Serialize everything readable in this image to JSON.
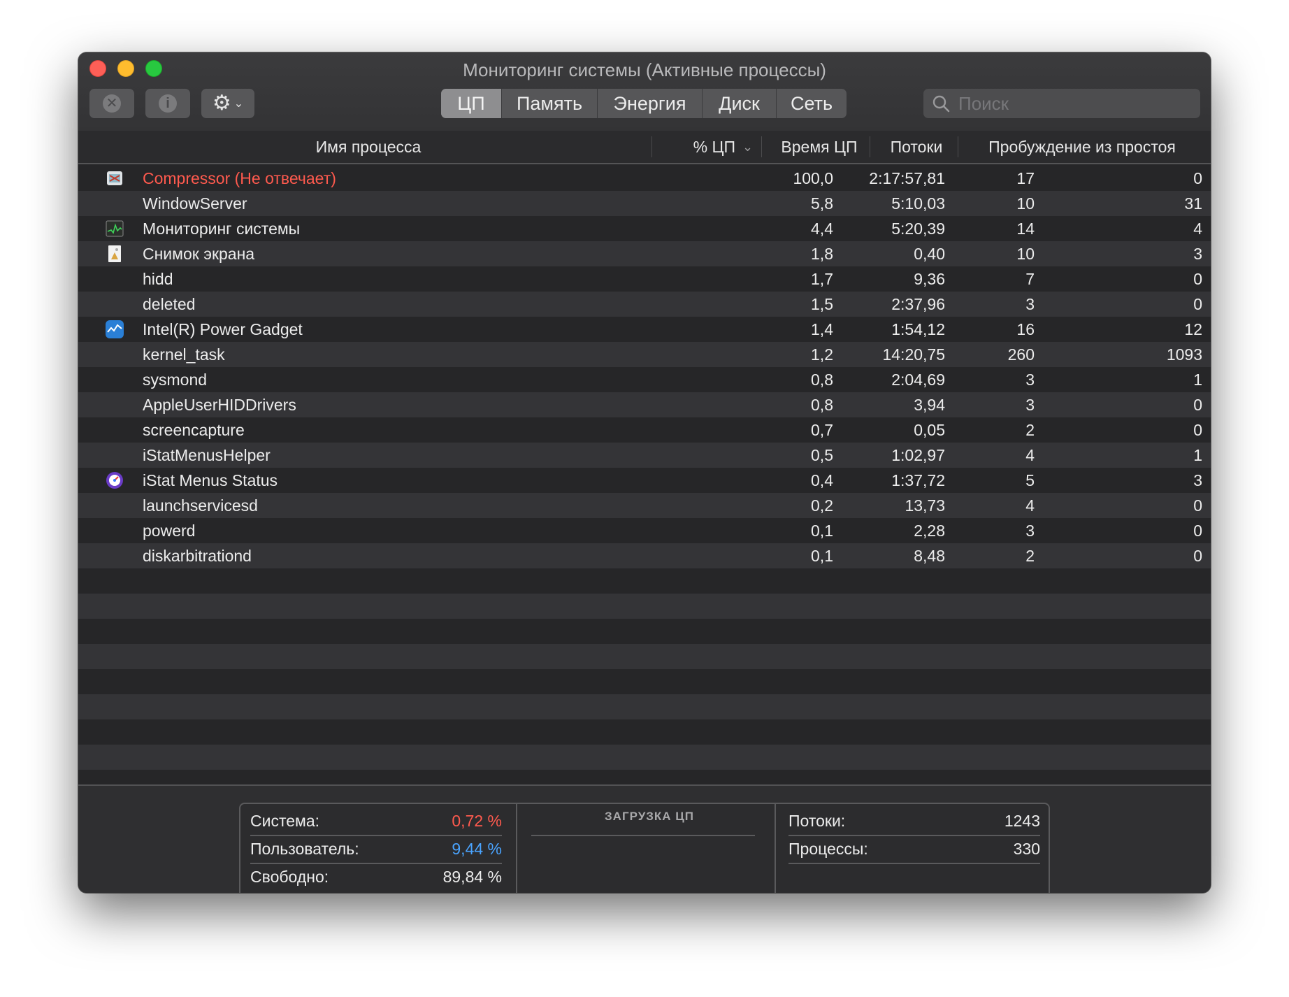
{
  "window": {
    "title": "Мониторинг системы (Активные процессы)"
  },
  "toolbar": {
    "stop_icon": "x-circle-icon",
    "info_icon": "info-icon",
    "gear_icon": "gear-icon",
    "tabs": [
      {
        "label": "ЦП",
        "active": true
      },
      {
        "label": "Память",
        "active": false
      },
      {
        "label": "Энергия",
        "active": false
      },
      {
        "label": "Диск",
        "active": false
      },
      {
        "label": "Сеть",
        "active": false
      }
    ],
    "search_placeholder": "Поиск",
    "search_value": ""
  },
  "table": {
    "columns": {
      "name": "Имя процесса",
      "cpu": "% ЦП",
      "time": "Время ЦП",
      "threads": "Потоки",
      "wake": "Пробуждение из простоя"
    },
    "sort": {
      "column": "cpu",
      "direction": "descending"
    },
    "rows": [
      {
        "icon": "compressor-app-icon",
        "name": "Compressor (Не отвечает)",
        "cpu": "100,0",
        "time": "2:17:57,81",
        "threads": "17",
        "wake": "0",
        "not_responding": true
      },
      {
        "icon": "",
        "name": "WindowServer",
        "cpu": "5,8",
        "time": "5:10,03",
        "threads": "10",
        "wake": "31"
      },
      {
        "icon": "activity-monitor-app-icon",
        "name": "Мониторинг системы",
        "cpu": "4,4",
        "time": "5:20,39",
        "threads": "14",
        "wake": "4"
      },
      {
        "icon": "screenshot-app-icon",
        "name": "Снимок экрана",
        "cpu": "1,8",
        "time": "0,40",
        "threads": "10",
        "wake": "3"
      },
      {
        "icon": "",
        "name": "hidd",
        "cpu": "1,7",
        "time": "9,36",
        "threads": "7",
        "wake": "0"
      },
      {
        "icon": "",
        "name": "deleted",
        "cpu": "1,5",
        "time": "2:37,96",
        "threads": "3",
        "wake": "0"
      },
      {
        "icon": "power-gadget-app-icon",
        "name": "Intel(R) Power Gadget",
        "cpu": "1,4",
        "time": "1:54,12",
        "threads": "16",
        "wake": "12"
      },
      {
        "icon": "",
        "name": "kernel_task",
        "cpu": "1,2",
        "time": "14:20,75",
        "threads": "260",
        "wake": "1093"
      },
      {
        "icon": "",
        "name": "sysmond",
        "cpu": "0,8",
        "time": "2:04,69",
        "threads": "3",
        "wake": "1"
      },
      {
        "icon": "",
        "name": "AppleUserHIDDrivers",
        "cpu": "0,8",
        "time": "3,94",
        "threads": "3",
        "wake": "0"
      },
      {
        "icon": "",
        "name": "screencapture",
        "cpu": "0,7",
        "time": "0,05",
        "threads": "2",
        "wake": "0"
      },
      {
        "icon": "",
        "name": "iStatMenusHelper",
        "cpu": "0,5",
        "time": "1:02,97",
        "threads": "4",
        "wake": "1"
      },
      {
        "icon": "istat-menus-app-icon",
        "name": "iStat Menus Status",
        "cpu": "0,4",
        "time": "1:37,72",
        "threads": "5",
        "wake": "3"
      },
      {
        "icon": "",
        "name": "launchservicesd",
        "cpu": "0,2",
        "time": "13,73",
        "threads": "4",
        "wake": "0"
      },
      {
        "icon": "",
        "name": "powerd",
        "cpu": "0,1",
        "time": "2,28",
        "threads": "3",
        "wake": "0"
      },
      {
        "icon": "",
        "name": "diskarbitrationd",
        "cpu": "0,1",
        "time": "8,48",
        "threads": "2",
        "wake": "0"
      }
    ]
  },
  "footer": {
    "system": {
      "label": "Система:",
      "value": "0,72 %"
    },
    "user": {
      "label": "Пользователь:",
      "value": "9,44 %"
    },
    "idle": {
      "label": "Свободно:",
      "value": "89,84 %"
    },
    "graph_title": "ЗАГРУЗКА ЦП",
    "threads": {
      "label": "Потоки:",
      "value": "1243"
    },
    "processes": {
      "label": "Процессы:",
      "value": "330"
    }
  },
  "colors": {
    "not_responding": "#ff5a4e",
    "system_load": "#ff5a4e",
    "user_load": "#4aa4ff",
    "window_bg": "#262628"
  }
}
